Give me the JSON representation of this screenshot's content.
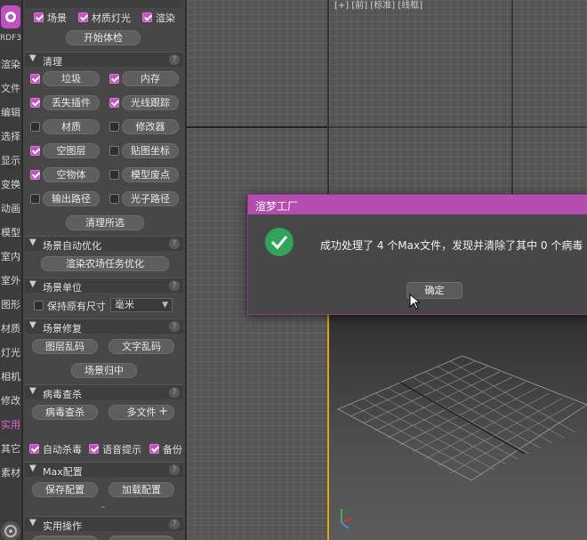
{
  "sidebar": {
    "version_label": "RDF3",
    "categories": [
      "渲染",
      "文件",
      "编辑",
      "选择",
      "显示",
      "变换",
      "动画",
      "模型",
      "室内",
      "室外",
      "图形",
      "材质",
      "灯光",
      "相机",
      "修改",
      "实用",
      "其它",
      "素材"
    ]
  },
  "panel": {
    "top_checks": [
      {
        "label": "场景",
        "checked": true
      },
      {
        "label": "材质灯光",
        "checked": true
      },
      {
        "label": "渲染",
        "checked": true
      }
    ],
    "start_check_label": "开始体检",
    "clean": {
      "title": "清理",
      "items": [
        {
          "label": "垃圾",
          "checked": true
        },
        {
          "label": "内存",
          "checked": true
        },
        {
          "label": "丢失插件",
          "checked": true
        },
        {
          "label": "光线跟踪",
          "checked": true
        },
        {
          "label": "材质",
          "checked": false
        },
        {
          "label": "修改器",
          "checked": false
        },
        {
          "label": "空图层",
          "checked": true
        },
        {
          "label": "贴图坐标",
          "checked": false
        },
        {
          "label": "空物体",
          "checked": true
        },
        {
          "label": "模型废点",
          "checked": false
        },
        {
          "label": "输出路径",
          "checked": false
        },
        {
          "label": "光子路径",
          "checked": false
        }
      ],
      "clean_all_label": "清理所选"
    },
    "auto_opt": {
      "title": "场景自动优化",
      "button": "渲染农场任务优化"
    },
    "units": {
      "title": "场景单位",
      "keep_size_label": "保持原有尺寸",
      "unit_value": "毫米"
    },
    "repair": {
      "title": "场景修复",
      "layer_garbled": "图层乱码",
      "text_garbled": "文字乱码",
      "scene_to_center": "场景归中"
    },
    "virus": {
      "title": "病毒查杀",
      "scan_label": "病毒查杀",
      "multi_file_label": "多文件",
      "auto_kill": "自动杀毒",
      "voice_prompt": "语音提示",
      "backup": "备份"
    },
    "max_config": {
      "title": "Max配置",
      "save_label": "保存配置",
      "load_label": "加载配置"
    },
    "practical": {
      "title": "实用操作"
    }
  },
  "viewport": {
    "top_label": "[+] [前] [标准] [线框]"
  },
  "dialog": {
    "title": "渲梦工厂",
    "message": "成功处理了 4 个Max文件，发现并清除了其中 0 个病毒",
    "ok_label": "确定"
  },
  "colors": {
    "accent": "#c64fc3",
    "dialog_title": "#b54db1",
    "success": "#2fa45a",
    "viewport_active": "#e0a800"
  }
}
